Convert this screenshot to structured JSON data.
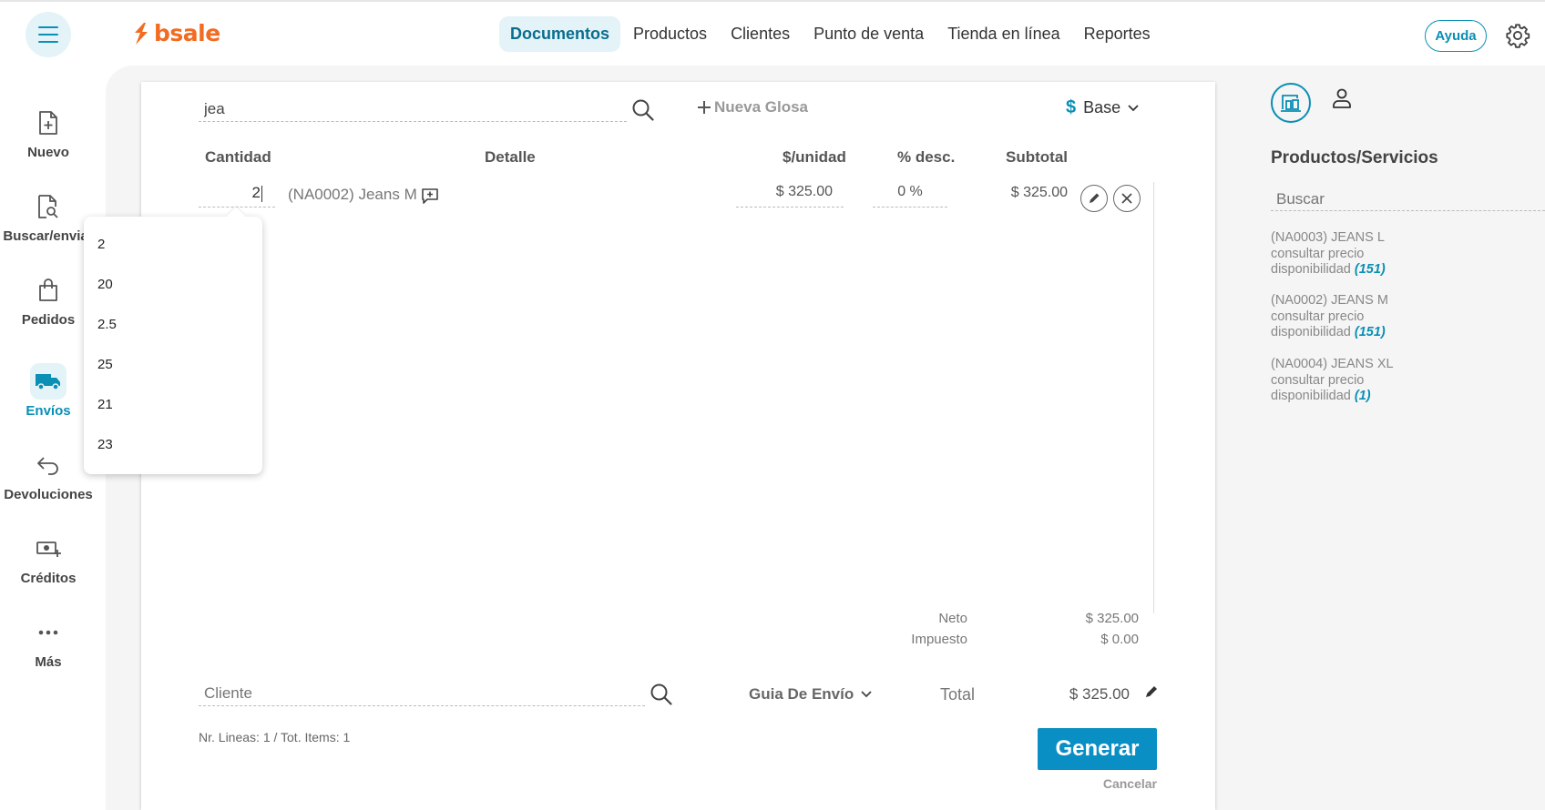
{
  "app": {
    "brand": "bsale"
  },
  "nav": {
    "items": [
      {
        "label": "Documentos",
        "active": true
      },
      {
        "label": "Productos"
      },
      {
        "label": "Clientes"
      },
      {
        "label": "Punto de venta"
      },
      {
        "label": "Tienda en línea"
      },
      {
        "label": "Reportes"
      }
    ],
    "help_label": "Ayuda"
  },
  "sidebar": {
    "items": [
      {
        "label": "Nuevo",
        "icon": "file-plus-icon"
      },
      {
        "label": "Buscar/enviar",
        "icon": "file-search-icon"
      },
      {
        "label": "Pedidos",
        "icon": "shopping-bag-icon"
      },
      {
        "label": "Envíos",
        "icon": "truck-icon",
        "active": true
      },
      {
        "label": "Devoluciones",
        "icon": "return-arrow-icon"
      },
      {
        "label": "Créditos",
        "icon": "money-plus-icon"
      },
      {
        "label": "Más",
        "icon": "more-dots-icon"
      }
    ]
  },
  "document": {
    "search_value": "jea",
    "new_gloss_label": "Nueva Glosa",
    "price_list": "Base",
    "price_list_symbol": "$",
    "columns": {
      "qty": "Cantidad",
      "detail": "Detalle",
      "unit_price": "$/unidad",
      "discount": "% desc.",
      "subtotal": "Subtotal"
    },
    "line": {
      "qty": "2",
      "detail": "(NA0002) Jeans M",
      "unit_price": "$ 325.00",
      "discount": "0 %",
      "subtotal": "$ 325.00"
    },
    "qty_suggestions": [
      "2",
      "20",
      "2.5",
      "25",
      "21",
      "23"
    ],
    "totals": {
      "neto_label": "Neto",
      "neto": "$ 325.00",
      "tax_label": "Impuesto",
      "tax": "$ 0.00",
      "total_label": "Total",
      "total": "$ 325.00"
    },
    "client_placeholder": "Cliente",
    "doc_type": "Guia De Envío",
    "lines_info": "Nr. Lineas: 1 / Tot. Items: 1",
    "generate_label": "Generar",
    "cancel_label": "Cancelar"
  },
  "right_panel": {
    "title": "Productos/Servicios",
    "search_placeholder": "Buscar",
    "products": [
      {
        "name": "(NA0003) JEANS L",
        "price": "consultar precio",
        "avail_label": "disponibilidad",
        "avail": "(151)"
      },
      {
        "name": "(NA0002) JEANS M",
        "price": "consultar precio",
        "avail_label": "disponibilidad",
        "avail": "(151)"
      },
      {
        "name": "(NA0004) JEANS XL",
        "price": "consultar precio",
        "avail_label": "disponibilidad",
        "avail": "(1)"
      }
    ]
  },
  "colors": {
    "accent": "#0a8fb5",
    "brand": "#f26b21",
    "button": "#0a8fc4"
  }
}
